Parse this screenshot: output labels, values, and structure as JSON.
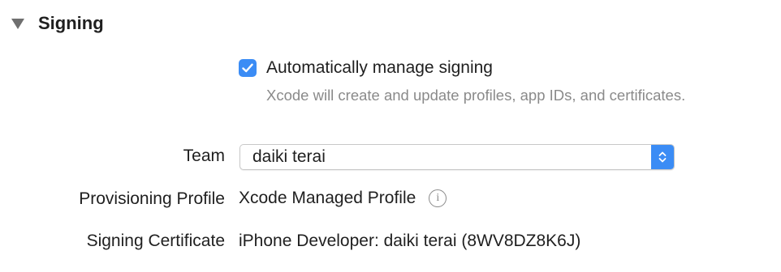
{
  "section": {
    "title": "Signing",
    "disclosure_icon": "disclosure-triangle-down-icon"
  },
  "auto_manage": {
    "label": "Automatically manage signing",
    "checked": true,
    "help_text": "Xcode will create and update profiles, app IDs, and certificates."
  },
  "team": {
    "label": "Team",
    "value": "daiki terai"
  },
  "provisioning_profile": {
    "label": "Provisioning Profile",
    "value": "Xcode Managed Profile",
    "info_icon": "info-icon",
    "info_glyph": "i"
  },
  "signing_certificate": {
    "label": "Signing Certificate",
    "value": "iPhone Developer: daiki terai (8WV8DZ8K6J)"
  },
  "colors": {
    "accent": "#3b8cf5",
    "secondary_text": "#8a8a8a",
    "primary_text": "#1f1f1f"
  }
}
